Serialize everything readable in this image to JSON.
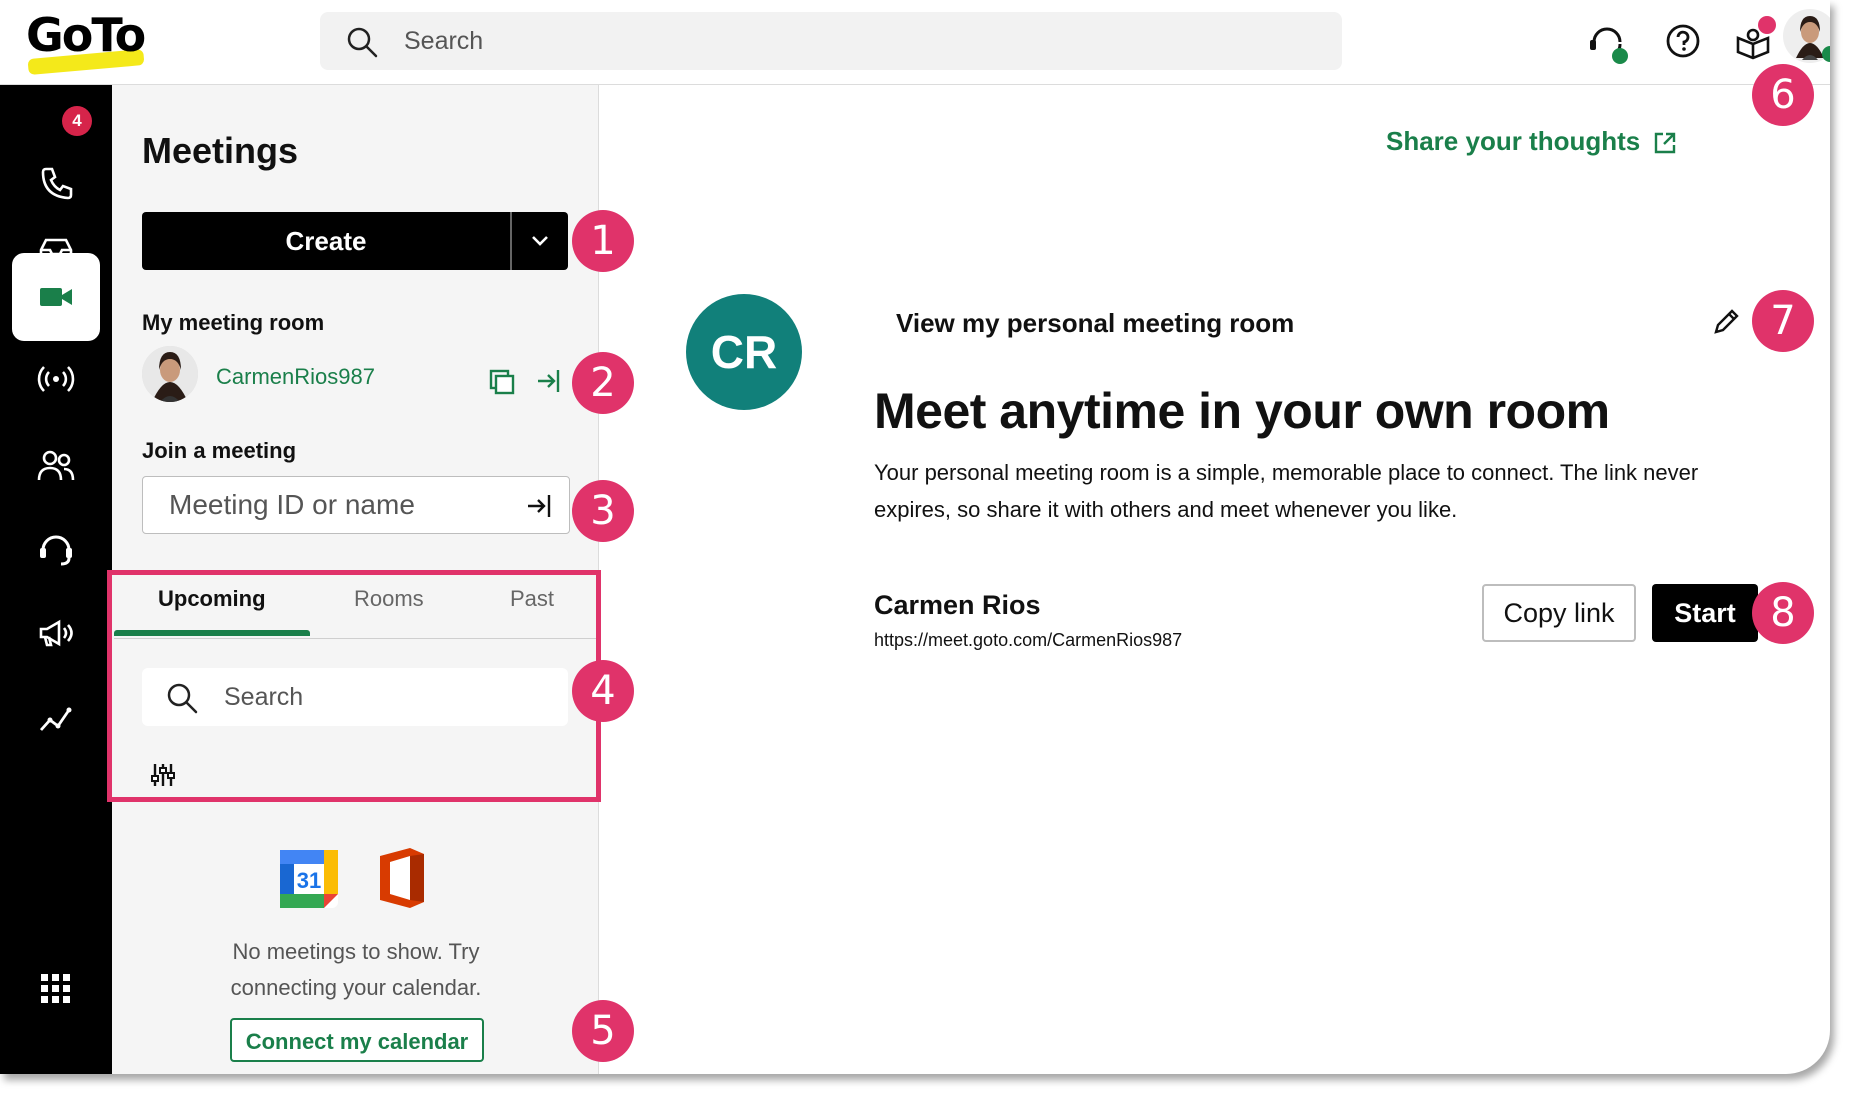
{
  "app": {
    "logo_text": "GoTo"
  },
  "topbar": {
    "search_placeholder": "Search"
  },
  "nav": {
    "calls_badge": "4"
  },
  "meetings": {
    "title": "Meetings",
    "create_label": "Create",
    "my_room_label": "My meeting room",
    "room_handle": "CarmenRios987",
    "join_label": "Join a meeting",
    "join_placeholder": "Meeting ID or name",
    "tabs": [
      "Upcoming",
      "Rooms",
      "Past"
    ],
    "list_search_placeholder": "Search",
    "empty_text": "No meetings to show. Try connecting your calendar.",
    "connect_label": "Connect my calendar",
    "calendar_day": "31"
  },
  "main": {
    "share_label": "Share your thoughts",
    "avatar_initials": "CR",
    "view_room_label": "View my personal meeting room",
    "headline": "Meet anytime in your own room",
    "description": "Your personal meeting room is a simple, memorable place to connect. The link never expires, so share it with others and meet whenever you like.",
    "owner_name": "Carmen Rios",
    "owner_url": "https://meet.goto.com/CarmenRios987",
    "copy_label": "Copy link",
    "start_label": "Start"
  },
  "callouts": [
    "1",
    "2",
    "3",
    "4",
    "5",
    "6",
    "7",
    "8"
  ],
  "colors": {
    "accent_green": "#1a7f4a",
    "callout_pink": "#e0336a",
    "avatar_teal": "#11807a"
  }
}
